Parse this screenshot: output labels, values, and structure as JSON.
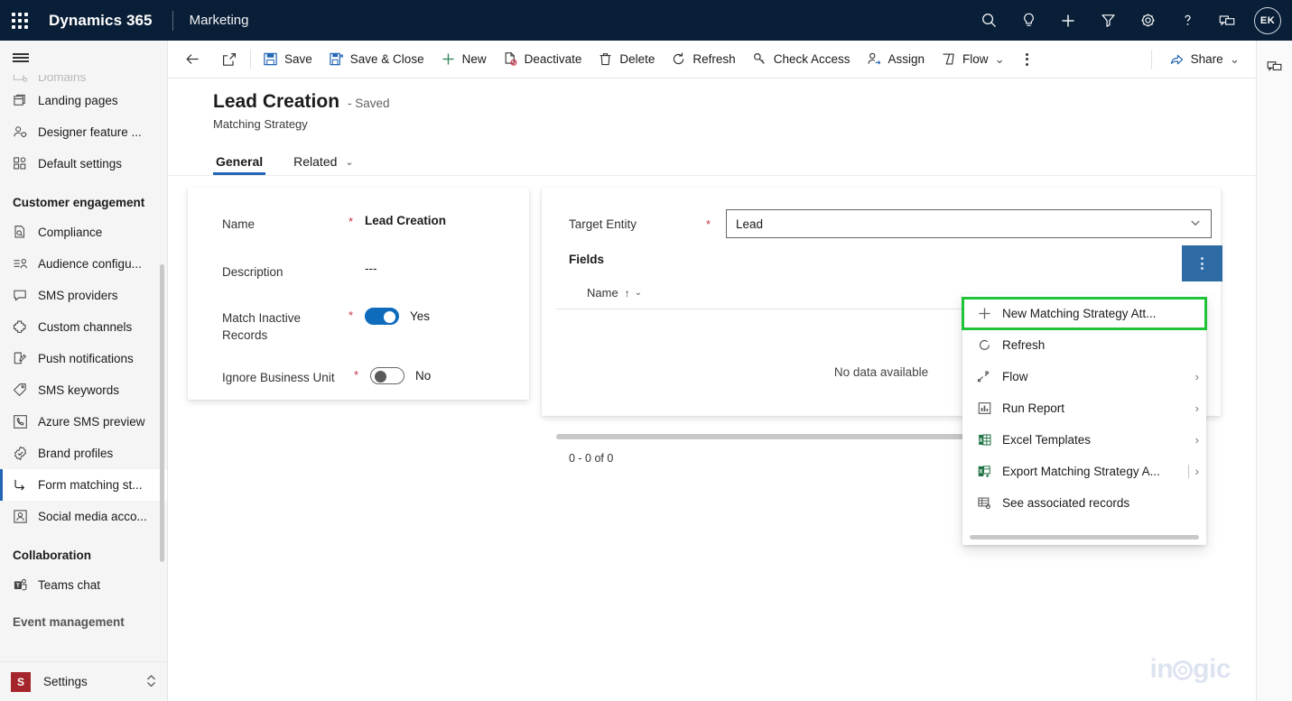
{
  "topbar": {
    "waffle_label": "app-launcher",
    "brand": "Dynamics 365",
    "app_name": "Marketing",
    "icons": [
      {
        "name": "search-icon",
        "label": "Search"
      },
      {
        "name": "lightbulb-icon",
        "label": "Insights"
      },
      {
        "name": "plus-icon",
        "label": "Quick create"
      },
      {
        "name": "filter-icon",
        "label": "Filter"
      },
      {
        "name": "gear-icon",
        "label": "Settings"
      },
      {
        "name": "help-icon",
        "label": "Help"
      },
      {
        "name": "feedback-icon",
        "label": "Feedback"
      }
    ],
    "avatar_initials": "EK"
  },
  "commandbar": {
    "back_label": "Back",
    "popout_label": "Open in new window",
    "items": [
      {
        "icon": "save-icon",
        "label": "Save"
      },
      {
        "icon": "save-close-icon",
        "label": "Save & Close"
      },
      {
        "icon": "plus-icon",
        "label": "New"
      },
      {
        "icon": "deactivate-icon",
        "label": "Deactivate"
      },
      {
        "icon": "delete-icon",
        "label": "Delete"
      },
      {
        "icon": "refresh-icon",
        "label": "Refresh"
      },
      {
        "icon": "check-access-icon",
        "label": "Check Access"
      },
      {
        "icon": "assign-icon",
        "label": "Assign"
      },
      {
        "icon": "flow-icon",
        "label": "Flow",
        "chevron": "⌄"
      }
    ],
    "overflow_label": "More commands",
    "share_label": "Share",
    "share_chevron": "⌄"
  },
  "sidebar": {
    "hamburger_label": "Collapse site map",
    "items_top": [
      {
        "icon": "domains-icon",
        "label": "Domains",
        "clipped": true
      },
      {
        "icon": "landing-pages-icon",
        "label": "Landing pages"
      },
      {
        "icon": "designer-feature-icon",
        "label": "Designer feature ..."
      },
      {
        "icon": "default-settings-icon",
        "label": "Default settings"
      }
    ],
    "group_customer_engagement": "Customer engagement",
    "items_ce": [
      {
        "icon": "compliance-icon",
        "label": "Compliance"
      },
      {
        "icon": "audience-config-icon",
        "label": "Audience configu..."
      },
      {
        "icon": "sms-providers-icon",
        "label": "SMS providers"
      },
      {
        "icon": "custom-channels-icon",
        "label": "Custom channels"
      },
      {
        "icon": "push-notifications-icon",
        "label": "Push notifications"
      },
      {
        "icon": "sms-keywords-icon",
        "label": "SMS keywords"
      },
      {
        "icon": "azure-sms-icon",
        "label": "Azure SMS preview"
      },
      {
        "icon": "brand-profiles-icon",
        "label": "Brand profiles"
      },
      {
        "icon": "form-matching-icon",
        "label": "Form matching st...",
        "selected": true
      },
      {
        "icon": "social-media-icon",
        "label": "Social media acco..."
      }
    ],
    "group_collaboration": "Collaboration",
    "items_collab": [
      {
        "icon": "teams-chat-icon",
        "label": "Teams chat"
      }
    ],
    "group_event_management": "Event management",
    "settings": {
      "badge": "S",
      "label": "Settings",
      "chevron": "⌃⌄"
    }
  },
  "page": {
    "title": "Lead Creation",
    "saved_status": "- Saved",
    "subtitle": "Matching Strategy",
    "tabs": [
      {
        "label": "General",
        "active": true
      },
      {
        "label": "Related",
        "active": false,
        "chevron": "⌄"
      }
    ]
  },
  "form": {
    "required_mark": "*",
    "fields": [
      {
        "label": "Name",
        "required": true,
        "value": "Lead Creation",
        "type": "text-bold"
      },
      {
        "label": "Description",
        "required": false,
        "value": "---",
        "type": "text"
      },
      {
        "label": "Match Inactive Records",
        "required": true,
        "value": "Yes",
        "type": "toggle",
        "on": true
      },
      {
        "label": "Ignore Business Unit",
        "required": true,
        "value": "No",
        "type": "toggle",
        "on": false
      }
    ]
  },
  "subgrid": {
    "target_entity_label": "Target Entity",
    "target_entity_value": "Lead",
    "target_entity_chevron": "⌄",
    "fields_title": "Fields",
    "overflow_label": "More commands",
    "column_header": "Name",
    "sort_arrow": "↑",
    "header_chevron": "⌄",
    "empty_message": "No data available",
    "record_count": "0 - 0 of 0"
  },
  "context_menu": {
    "items": [
      {
        "icon": "plus-icon",
        "label": "New Matching Strategy Att...",
        "highlighted": true,
        "submenu": false
      },
      {
        "icon": "refresh-icon",
        "label": "Refresh",
        "submenu": false
      },
      {
        "icon": "flow-icon",
        "label": "Flow",
        "submenu": true,
        "chevron": "›"
      },
      {
        "icon": "run-report-icon",
        "label": "Run Report",
        "submenu": true,
        "chevron": "›"
      },
      {
        "icon": "excel-templates-icon",
        "label": "Excel Templates",
        "submenu": true,
        "chevron": "›"
      },
      {
        "icon": "export-excel-icon",
        "label": "Export Matching Strategy A...",
        "submenu": true,
        "split": true,
        "chevron": "›"
      },
      {
        "icon": "associated-records-icon",
        "label": "See associated records",
        "submenu": false
      }
    ]
  },
  "rightrail": {
    "items": [
      {
        "icon": "feedback-icon",
        "label": "Feedback"
      }
    ]
  },
  "watermark": {
    "prefix": "in",
    "suffix": "gic"
  },
  "colors": {
    "nav_bg": "#091F38",
    "accent": "#2266b5",
    "toggle_on": "#0f6cbd",
    "required": "#c4314b",
    "highlight": "#1ec337",
    "overflow_btn": "#2e6ba5",
    "settings_badge": "#a4262c"
  }
}
